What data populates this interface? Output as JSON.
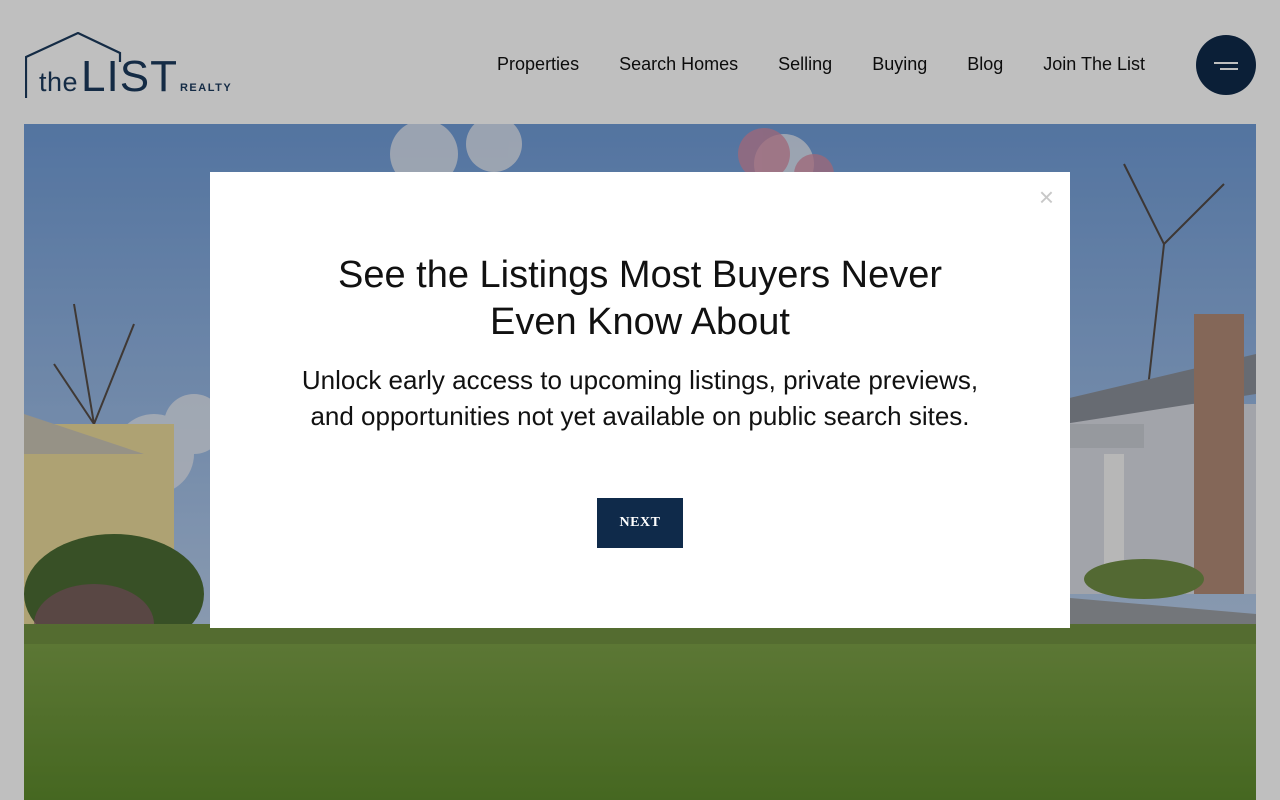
{
  "logo": {
    "the": "the",
    "list": "LIST",
    "realty": "REALTY",
    "color": "#1b3a5c"
  },
  "nav": {
    "items": [
      {
        "label": "Properties"
      },
      {
        "label": "Search Homes"
      },
      {
        "label": "Selling"
      },
      {
        "label": "Buying"
      },
      {
        "label": "Blog"
      },
      {
        "label": "Join The List"
      }
    ]
  },
  "menu_button": {
    "icon": "hamburger-icon",
    "color": "#0f2a4a"
  },
  "hero": {
    "description_icon": "hero-house-photo"
  },
  "modal": {
    "close_icon": "close-icon",
    "close_glyph": "×",
    "title": "See the Listings Most Buyers Never Even Know About",
    "body": "Unlock early access to upcoming listings, private previews, and opportunities not yet available on public search sites.",
    "button_label": "NEXT",
    "button_color": "#0f2a4a"
  }
}
